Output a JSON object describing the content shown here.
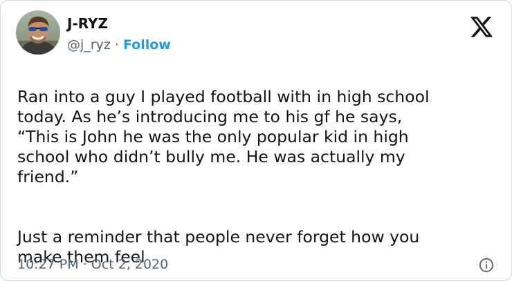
{
  "user": {
    "display_name": "J-RYZ",
    "handle": "@j_ryz",
    "separator": "·",
    "follow_label": "Follow"
  },
  "tweet": {
    "paragraph_1": "Ran into a guy I played football with in high school\ntoday. As he’s introducing me to his gf he says,\n“This is John he was the only popular kid in high\nschool who didn’t bully me. He was actually my\nfriend.”",
    "paragraph_2": "Just a reminder that people never forget how you\nmake them feel",
    "time": "10:27 PM",
    "date_separator": "·",
    "date": "Oct 2, 2020"
  },
  "icons": {
    "logo": "x-logo-icon",
    "info": "info-icon"
  },
  "colors": {
    "text_primary": "#0f1419",
    "text_secondary": "#536471",
    "accent": "#1d9bf0"
  }
}
